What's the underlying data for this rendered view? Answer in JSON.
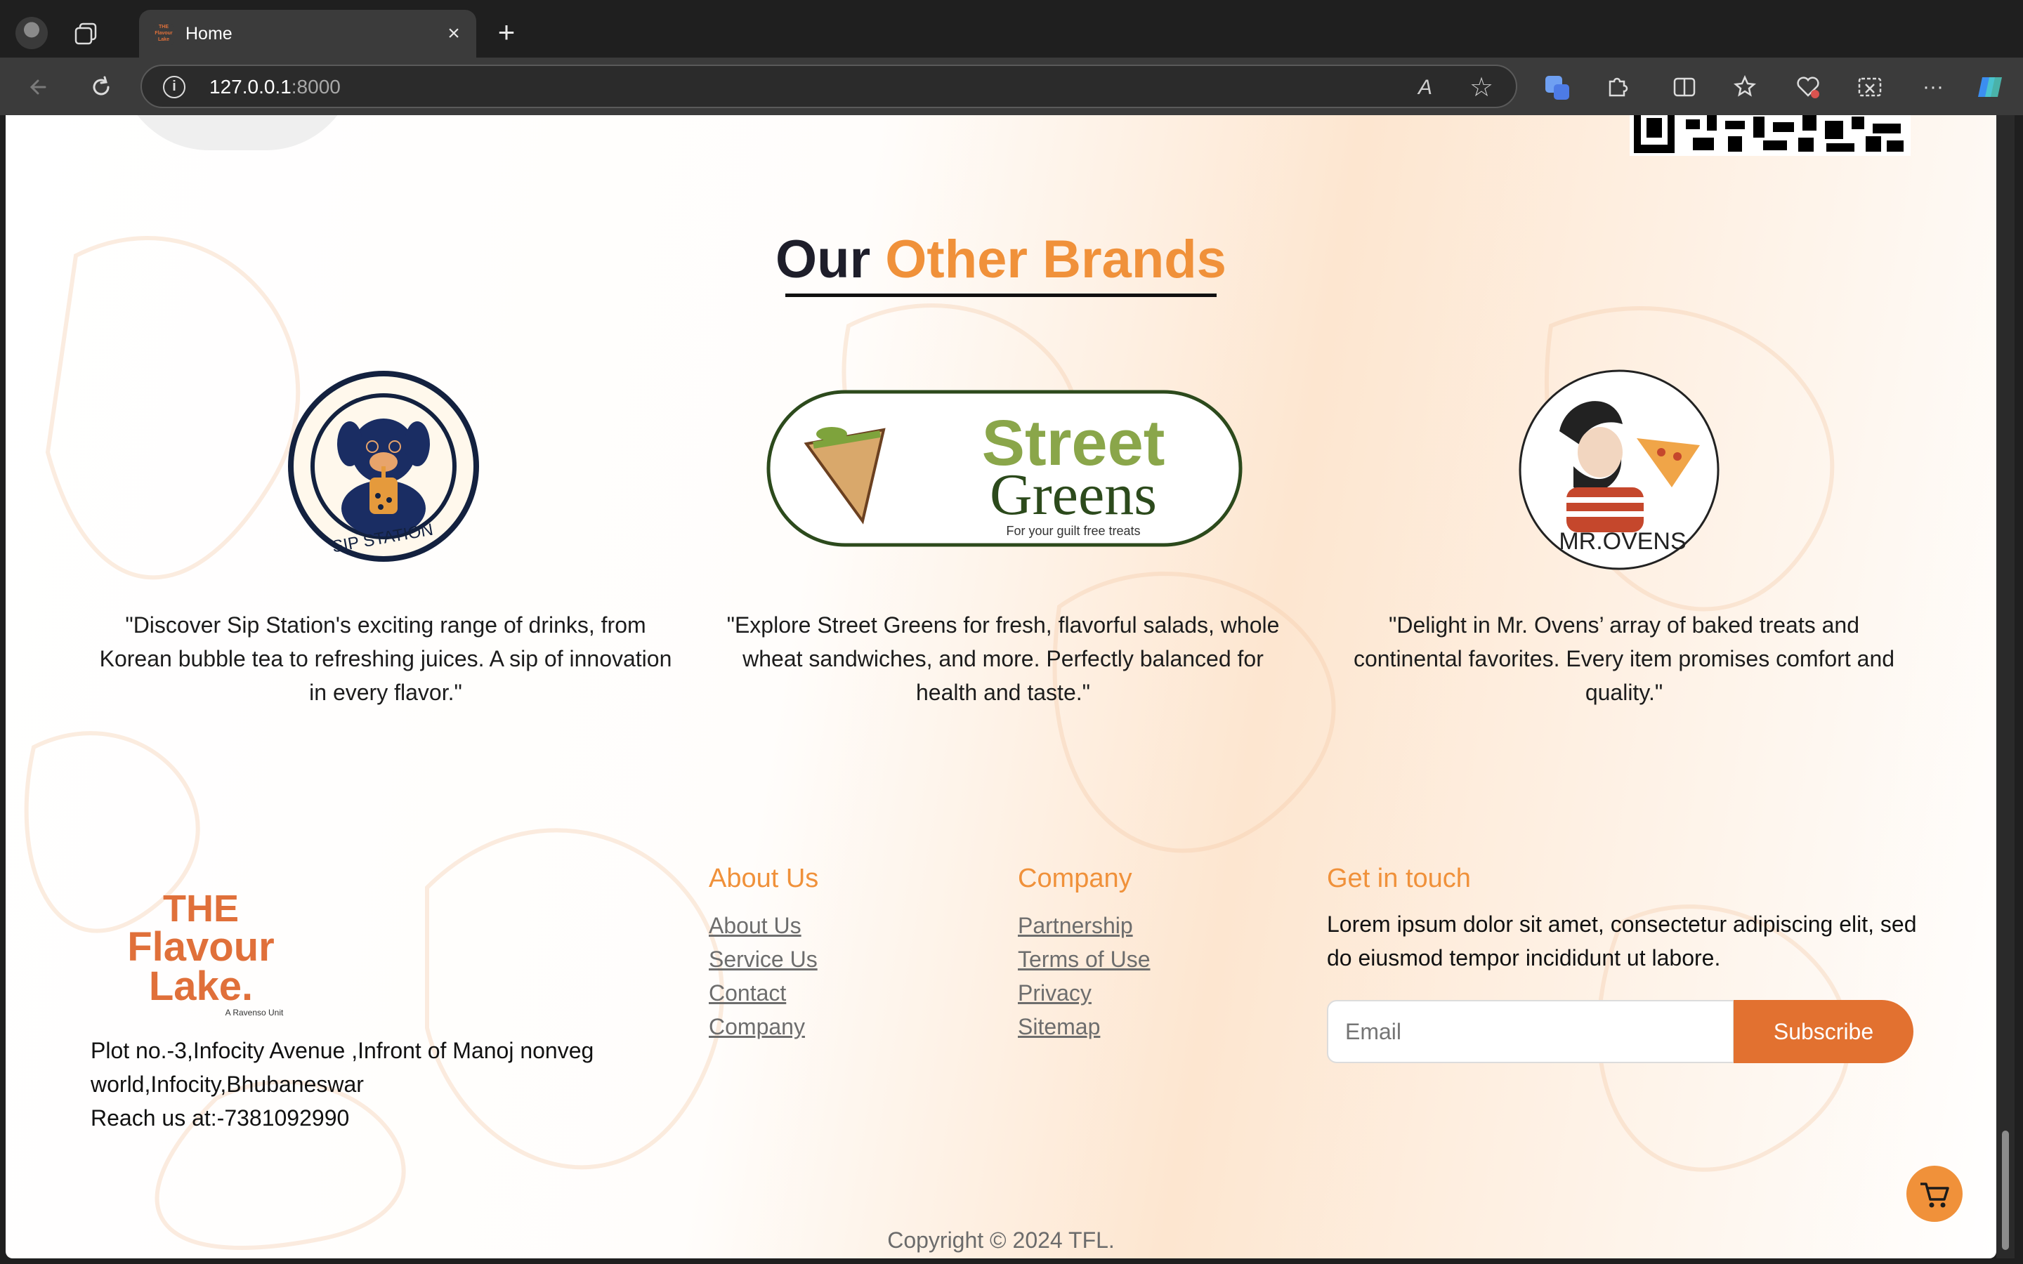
{
  "browser": {
    "tab_title": "Home",
    "favicon_text": "THE Flavour Lake",
    "tab_close": "×",
    "new_tab": "+",
    "url_host": "127.0.0.1",
    "url_port": ":8000",
    "info_glyph": "i",
    "read_aloud_glyph": "A",
    "favorite_glyph": "☆",
    "more_glyph": "···"
  },
  "page": {
    "brands_title_plain": "Our ",
    "brands_title_accent": "Other Brands",
    "brands": [
      {
        "name": "SIP STATION",
        "description": "\"Discover Sip Station's exciting range of drinks, from Korean bubble tea to refreshing juices. A sip of innovation in every flavor.\""
      },
      {
        "name_line1": "Street",
        "name_line2": "Greens",
        "tagline": "For your guilt free treats",
        "description": "\"Explore Street Greens for fresh, flavorful salads, whole wheat sandwiches, and more. Perfectly balanced for health and taste.\""
      },
      {
        "name": "MR.OVENS",
        "description": "\"Delight in Mr. Ovens’ array of baked treats and continental favorites. Every item promises comfort and quality.\""
      }
    ],
    "footer": {
      "logo_line1": "THE",
      "logo_line2": "Flavour",
      "logo_line3": "Lake.",
      "logo_sub": "A Ravenso Unit",
      "address_line1": "Plot no.-3,Infocity Avenue ,Infront of Manoj nonveg",
      "address_line2": "world,Infocity,Bhubaneswar",
      "address_line3": "Reach us at:-7381092990",
      "about_heading": "About Us",
      "about_links": [
        "About Us",
        "Service Us",
        "Contact",
        "Company"
      ],
      "company_heading": "Company",
      "company_links": [
        "Partnership",
        "Terms of Use",
        "Privacy",
        "Sitemap"
      ],
      "touch_heading": "Get in touch",
      "touch_text": "Lorem ipsum dolor sit amet, consectetur adipiscing elit, sed do eiusmod tempor incididunt ut labore.",
      "email_placeholder": "Email",
      "subscribe_label": "Subscribe",
      "copyright": "Copyright © 2024 TFL."
    }
  },
  "colors": {
    "accent": "#f0913a",
    "button": "#e27130",
    "logo": "#e0703a",
    "street_green": "#8aa64a",
    "street_dark": "#2c4a1c"
  }
}
